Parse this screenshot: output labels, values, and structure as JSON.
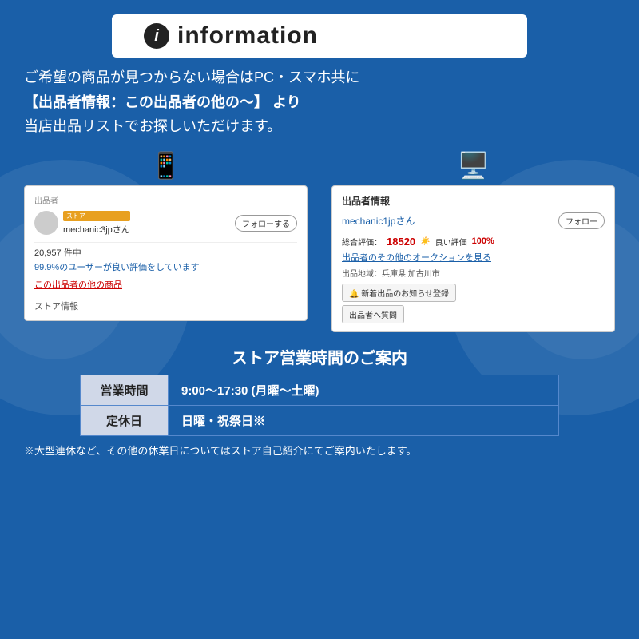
{
  "header": {
    "title": "information",
    "icon_label": "i"
  },
  "description": {
    "line1": "ご希望の商品が見つからない場合はPC・スマホ共に",
    "line2": "【出品者情報：この出品者の他の〜】 より",
    "line3": "当店出品リストでお探しいただけます。"
  },
  "mobile_mock": {
    "device_icon": "📱",
    "section_label": "出品者",
    "store_badge": "ストア",
    "seller_name": "mechanic3jpさん",
    "follow_button": "フォローする",
    "review_count": "20,957 件中",
    "review_percent": "99.9%のユーザーが良い評価をしています",
    "other_link": "この出品者の他の商品",
    "store_info": "ストア情報"
  },
  "pc_mock": {
    "device_icon": "💻",
    "section_label": "出品者情報",
    "seller_name": "mechanic1jpさん",
    "follow_button": "フォロー",
    "rating_label": "総合評価：",
    "rating_num": "18520",
    "rating_good_icon": "☀",
    "rating_good_label": "良い評価",
    "rating_percent": "100%",
    "auction_link": "出品者のその他のオークションを見る",
    "location_label": "出品地域：兵庫県 加古川市",
    "notify_button": "🔔 新着出品のお知らせ登録",
    "question_button": "出品者へ質問"
  },
  "hours": {
    "title": "ストア営業時間のご案内",
    "rows": [
      {
        "label": "営業時間",
        "value": "9:00〜17:30 (月曜〜土曜)"
      },
      {
        "label": "定休日",
        "value": "日曜・祝祭日※"
      }
    ],
    "footnote": "※大型連休など、その他の休業日についてはストア自己紹介にてご案内いたします。"
  }
}
